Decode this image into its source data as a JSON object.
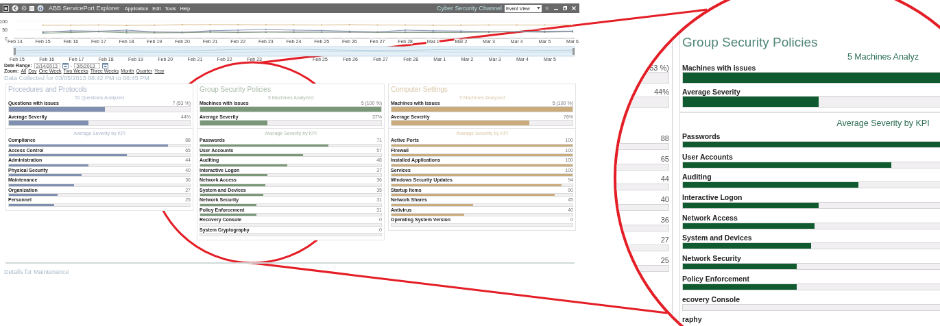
{
  "window": {
    "title": "ABB ServicePort Explorer",
    "menu": [
      "Application",
      "Edit",
      "Tools",
      "Help"
    ],
    "channel": "Cyber Security Channel",
    "view_select": "Event View"
  },
  "trend": {
    "chart_data": {
      "type": "line",
      "categories": [
        "Feb 14",
        "Feb 15",
        "Feb 16",
        "Feb 17",
        "Feb 18",
        "Feb 19",
        "Feb 20",
        "Feb 21",
        "Feb 22",
        "Feb 23",
        "Feb 24",
        "Feb 25",
        "Feb 26",
        "Feb 27",
        "Feb 28",
        "Mar 1",
        "Mar 2",
        "Mar 3",
        "Mar 4",
        "Mar 5",
        "Mar 6"
      ],
      "yticks": [
        0,
        50,
        100
      ],
      "ylim": [
        0,
        100
      ],
      "series": [
        {
          "color": "#d2b078",
          "values": [
            null,
            77,
            77,
            78,
            76,
            77,
            80,
            80,
            80,
            79,
            79,
            78,
            80,
            78,
            78,
            77,
            77,
            78,
            78,
            78,
            78
          ]
        },
        {
          "color": "#7b8fb2",
          "values": [
            null,
            35,
            45,
            42,
            48,
            38,
            35,
            45,
            48,
            52,
            48,
            46,
            42,
            38,
            48,
            45,
            43,
            40,
            40,
            42,
            43
          ]
        },
        {
          "color": "#7e9c7c",
          "values": [
            null,
            30,
            34,
            38,
            33,
            32,
            33,
            36,
            34,
            36,
            35,
            36,
            37,
            35,
            35,
            34,
            35,
            36,
            38,
            37,
            38
          ]
        },
        {
          "color": "#8a8a8a",
          "values": [
            null,
            38,
            38,
            40,
            40,
            36,
            36,
            38,
            36,
            38,
            38,
            37,
            36,
            36,
            36,
            37,
            37,
            38,
            38,
            37,
            39
          ]
        }
      ]
    }
  },
  "navigator": {
    "labels_left": [
      "Feb 15",
      "Feb 16",
      "Feb 17",
      "Feb 18",
      "Feb 19",
      "Feb 20",
      "Feb 21",
      "Feb 22",
      "Feb 23"
    ],
    "labels_right": [
      "Feb 25",
      "Feb 26",
      "Feb 27",
      "Feb 28",
      "Mar 1",
      "Mar 2",
      "Mar 3",
      "Mar 4",
      "Mar 5"
    ]
  },
  "date_range": {
    "label": "Date Range:",
    "from": "2/14/2013",
    "separator": "-",
    "to": "3/5/2013",
    "zoom_label": "Zoom:",
    "zoom_options": [
      "All",
      "Day",
      "One Week",
      "Two Weeks",
      "Three Weeks",
      "Month",
      "Quarter",
      "Year"
    ]
  },
  "collected": "Data Collected for 03/05/2013 08:42 PM to 08:45 PM",
  "panels": [
    {
      "title": "Procedures and Protocols",
      "color": "#7f8fb0",
      "subtitle": "51 Questions Analyzed",
      "metrics": [
        {
          "label": "Questions with issues",
          "value": "7 (53 %)",
          "level": 0.53
        },
        {
          "label": "Average Severity",
          "value": "44%",
          "level": 0.44
        }
      ],
      "kpi_title": "Average Severity by KPI",
      "kpis": [
        {
          "label": "Compliance",
          "value": "88",
          "level": 0.88
        },
        {
          "label": "Access Control",
          "value": "65",
          "level": 0.65
        },
        {
          "label": "Administration",
          "value": "44",
          "level": 0.44
        },
        {
          "label": "Physical Security",
          "value": "40",
          "level": 0.4
        },
        {
          "label": "Maintenance",
          "value": "36",
          "level": 0.36
        },
        {
          "label": "Organization",
          "value": "27",
          "level": 0.27
        },
        {
          "label": "Personnel",
          "value": "25",
          "level": 0.25
        }
      ]
    },
    {
      "title": "Group Security Policies",
      "color": "#7a9878",
      "subtitle": "5 Machines Analyzed",
      "metrics": [
        {
          "label": "Machines with issues",
          "value": "5 (100 %)",
          "level": 1
        },
        {
          "label": "Average Severity",
          "value": "37%",
          "level": 0.37
        }
      ],
      "kpi_title": "Average Severity by KPI",
      "kpis": [
        {
          "label": "Passwords",
          "value": "71",
          "level": 0.71
        },
        {
          "label": "User Accounts",
          "value": "57",
          "level": 0.57
        },
        {
          "label": "Auditing",
          "value": "48",
          "level": 0.48
        },
        {
          "label": "Interactive Logon",
          "value": "37",
          "level": 0.37
        },
        {
          "label": "Network Access",
          "value": "36",
          "level": 0.36
        },
        {
          "label": "System and Devices",
          "value": "35",
          "level": 0.35
        },
        {
          "label": "Network Security",
          "value": "31",
          "level": 0.31
        },
        {
          "label": "Policy Enforcement",
          "value": "31",
          "level": 0.31
        },
        {
          "label": "Recovery Console",
          "value": "0",
          "level": 0
        },
        {
          "label": "System Cryptography",
          "value": "0",
          "level": 0
        }
      ]
    },
    {
      "title": "Computer Settings",
      "color": "#c9ab7c",
      "subtitle": "5 Machines Analyzed",
      "metrics": [
        {
          "label": "Machines with issues",
          "value": "5 (100 %)",
          "level": 1
        },
        {
          "label": "Average Severity",
          "value": "76%",
          "level": 0.76
        }
      ],
      "kpi_title": "Average Severity by KPI",
      "kpis": [
        {
          "label": "Active Ports",
          "value": "100",
          "level": 1
        },
        {
          "label": "Firewall",
          "value": "100",
          "level": 1
        },
        {
          "label": "Installed Applications",
          "value": "100",
          "level": 1
        },
        {
          "label": "Services",
          "value": "100",
          "level": 1
        },
        {
          "label": "Windows Security Updates",
          "value": "94",
          "level": 0.94
        },
        {
          "label": "Startup Items",
          "value": "90",
          "level": 0.9
        },
        {
          "label": "Network Shares",
          "value": "45",
          "level": 0.45
        },
        {
          "label": "Antivirus",
          "value": "40",
          "level": 0.4
        },
        {
          "label": "Operating System Version",
          "value": "0",
          "level": 0
        }
      ]
    }
  ],
  "details_title": "Details for Maintenance",
  "magnifier": {
    "side_values": [
      "53 %)",
      "44%",
      "88",
      "65",
      "44",
      "40",
      "36",
      "27",
      "25"
    ],
    "panel": {
      "title": "Group Security Policies",
      "subtitle": "5 Machines Analyz",
      "color": "#0f5a2f",
      "metrics": [
        {
          "label": "Machines with issues",
          "level": 1
        },
        {
          "label": "Average Severity",
          "level": 0.37
        }
      ],
      "kpi_title": "Average Severity by KPI",
      "kpis": [
        {
          "label": "Passwords",
          "level": 0.71
        },
        {
          "label": "User Accounts",
          "level": 0.57
        },
        {
          "label": "Auditing",
          "level": 0.48
        },
        {
          "label": "Interactive Logon",
          "level": 0.37
        },
        {
          "label": "Network Access",
          "level": 0.36
        },
        {
          "label": "System and Devices",
          "level": 0.35
        },
        {
          "label": "Network Security",
          "level": 0.31
        },
        {
          "label": "Policy Enforcement",
          "level": 0.31
        },
        {
          "label": "ecovery Console",
          "level": 0
        },
        {
          "label": "raphy"
        }
      ]
    }
  }
}
